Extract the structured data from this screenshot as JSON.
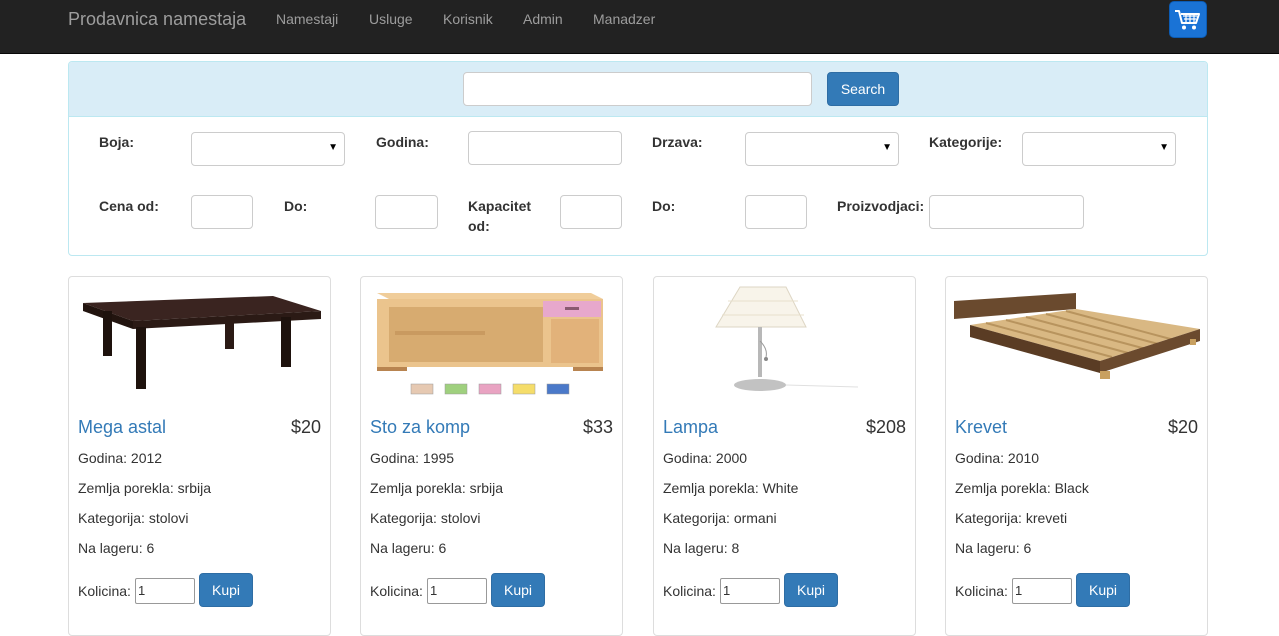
{
  "navbar": {
    "brand": "Prodavnica namestaja",
    "links": [
      "Namestaji",
      "Usluge",
      "Korisnik",
      "Admin",
      "Manadzer"
    ],
    "cart_icon": "shopping-cart-icon"
  },
  "search": {
    "value": "",
    "button_label": "Search"
  },
  "filters": {
    "boja_label": "Boja:",
    "godina_label": "Godina:",
    "drzava_label": "Drzava:",
    "kategorije_label": "Kategorije:",
    "cena_od_label": "Cena od:",
    "cena_do_label": "Do:",
    "kapacitet_od_label_line1": "Kapacitet",
    "kapacitet_od_label_line2": "od:",
    "kapacitet_do_label": "Do:",
    "proizvodjaci_label": "Proizvodjaci:"
  },
  "products": [
    {
      "name": "Mega astal",
      "price": "$20",
      "year": "Godina: 2012",
      "origin": "Zemlja porekla: srbija",
      "category": "Kategorija: stolovi",
      "stock": "Na lageru: 6",
      "qty_label": "Kolicina:",
      "qty": "1",
      "buy": "Kupi",
      "image": "coffee-table"
    },
    {
      "name": "Sto za komp",
      "price": "$33",
      "year": "Godina: 1995",
      "origin": "Zemlja porekla: srbija",
      "category": "Kategorija: stolovi",
      "stock": "Na lageru: 6",
      "qty_label": "Kolicina:",
      "qty": "1",
      "buy": "Kupi",
      "image": "computer-desk"
    },
    {
      "name": "Lampa",
      "price": "$208",
      "year": "Godina: 2000",
      "origin": "Zemlja porekla: White",
      "category": "Kategorija: ormani",
      "stock": "Na lageru: 8",
      "qty_label": "Kolicina:",
      "qty": "1",
      "buy": "Kupi",
      "image": "table-lamp"
    },
    {
      "name": "Krevet",
      "price": "$20",
      "year": "Godina: 2010",
      "origin": "Zemlja porekla: Black",
      "category": "Kategorija: kreveti",
      "stock": "Na lageru: 6",
      "qty_label": "Kolicina:",
      "qty": "1",
      "buy": "Kupi",
      "image": "bed-frame"
    }
  ],
  "colors": {
    "navbar_bg": "#222222",
    "nav_text": "#9d9d9d",
    "primary": "#337ab7",
    "panel_head": "#d9edf7",
    "cart_blue": "#1a73d6"
  }
}
